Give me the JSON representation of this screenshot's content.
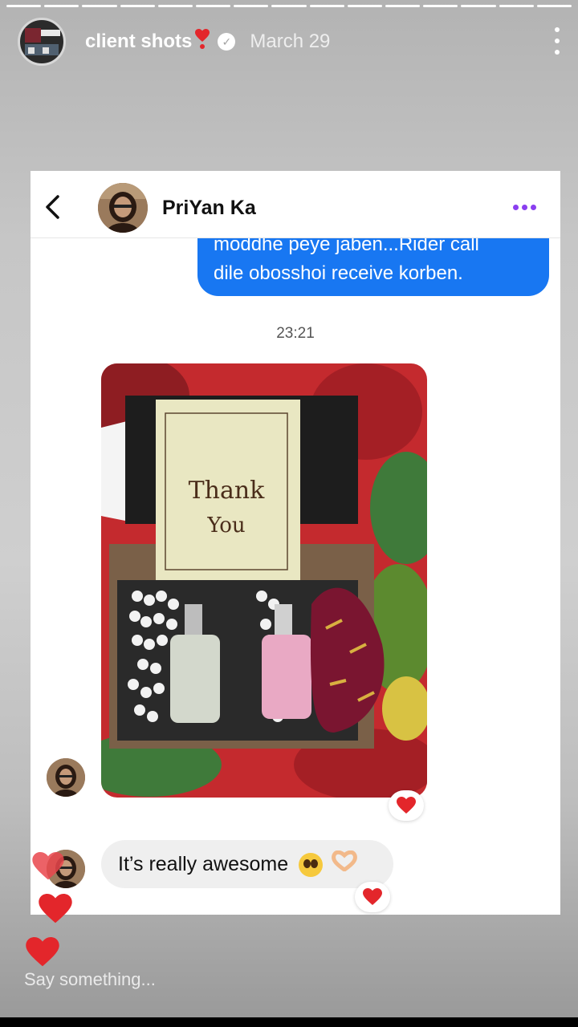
{
  "story": {
    "username": "client shots",
    "date": "March 29",
    "progress_segments": 15,
    "progress_done": 15,
    "reply_placeholder": "Say something..."
  },
  "chat": {
    "contact_name": "PriYan Ka",
    "sent_message_line1": "moddhe peye jaben...Rider call",
    "sent_message_line2": "dile obosshoi receive korben.",
    "timestamp": "23:21",
    "photo_card_line1": "Thank",
    "photo_card_line2": "You",
    "received_message": "It’s really awesome"
  },
  "colors": {
    "sent_bubble": "#1877f2",
    "received_bubble": "#efefef",
    "heart": "#e3262b",
    "options_dots": "#8a3ff0"
  },
  "icons": [
    "heart-exclamation-icon",
    "verified-badge-icon",
    "more-options-icon",
    "back-arrow-icon",
    "options-dots-icon",
    "heart-reaction-icon",
    "pleading-face-emoji-icon",
    "heart-hands-emoji-icon"
  ]
}
